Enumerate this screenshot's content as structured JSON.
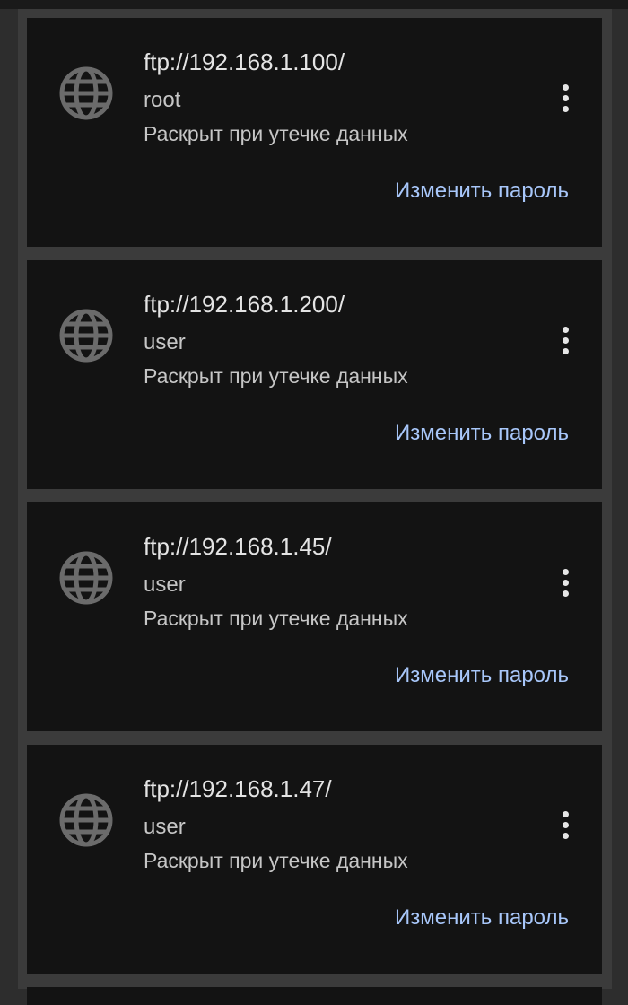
{
  "colors": {
    "background": "#2d2d2d",
    "card": "#131313",
    "primary_text": "#e4e4e4",
    "secondary_text": "#c6c6c6",
    "accent": "#a8c7fa",
    "icon": "#6b6b6b"
  },
  "icons": {
    "site": "globe-icon",
    "menu": "more-vert-icon"
  },
  "items": [
    {
      "url": "ftp://192.168.1.100/",
      "username": "root",
      "status": "Раскрыт при утечке данных",
      "action_label": "Изменить пароль"
    },
    {
      "url": "ftp://192.168.1.200/",
      "username": "user",
      "status": "Раскрыт при утечке данных",
      "action_label": "Изменить пароль"
    },
    {
      "url": "ftp://192.168.1.45/",
      "username": "user",
      "status": "Раскрыт при утечке данных",
      "action_label": "Изменить пароль"
    },
    {
      "url": "ftp://192.168.1.47/",
      "username": "user",
      "status": "Раскрыт при утечке данных",
      "action_label": "Изменить пароль"
    }
  ]
}
